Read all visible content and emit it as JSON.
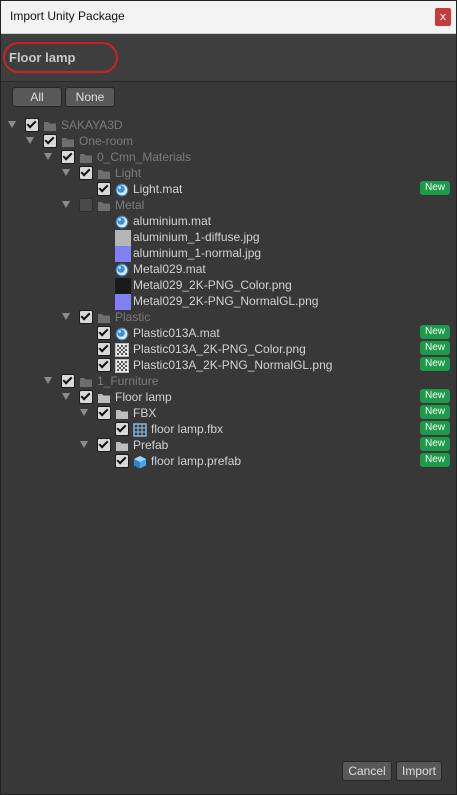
{
  "window": {
    "title": "Import Unity Package",
    "close_glyph": "x"
  },
  "package": {
    "name": "Floor lamp",
    "highlight_color": "#cc2222"
  },
  "toolbar": {
    "all_label": "All",
    "none_label": "None"
  },
  "colors": {
    "new_badge": "#1d9a4a",
    "background": "#383838",
    "title_bar": "#f3f3f3",
    "close_button": "#c43c3c"
  },
  "tree": [
    {
      "label": "SAKAYA3D",
      "depth": 0,
      "icon": "folder-icon",
      "expanded": true,
      "checked": true,
      "dim": true,
      "is_new": false
    },
    {
      "label": "One-room",
      "depth": 1,
      "icon": "folder-icon",
      "expanded": true,
      "checked": true,
      "dim": true,
      "is_new": false
    },
    {
      "label": "0_Cmn_Materials",
      "depth": 2,
      "icon": "folder-icon",
      "expanded": true,
      "checked": true,
      "dim": true,
      "is_new": false
    },
    {
      "label": "Light",
      "depth": 3,
      "icon": "folder-icon",
      "expanded": true,
      "checked": true,
      "dim": true,
      "is_new": false
    },
    {
      "label": "Light.mat",
      "depth": 4,
      "icon": "material-sphere-icon",
      "expanded": null,
      "checked": true,
      "dim": false,
      "is_new": true
    },
    {
      "label": "Metal",
      "depth": 3,
      "icon": "folder-icon",
      "expanded": true,
      "checked": false,
      "dim": true,
      "is_new": false
    },
    {
      "label": "aluminium.mat",
      "depth": 4,
      "icon": "material-sphere-icon",
      "expanded": null,
      "checked": null,
      "dim": false,
      "is_new": false
    },
    {
      "label": "aluminium_1-diffuse.jpg",
      "depth": 4,
      "icon": "texture-gray-icon",
      "expanded": null,
      "checked": null,
      "dim": false,
      "is_new": false
    },
    {
      "label": "aluminium_1-normal.jpg",
      "depth": 4,
      "icon": "texture-normal-icon",
      "expanded": null,
      "checked": null,
      "dim": false,
      "is_new": false
    },
    {
      "label": "Metal029.mat",
      "depth": 4,
      "icon": "material-sphere-icon",
      "expanded": null,
      "checked": null,
      "dim": false,
      "is_new": false
    },
    {
      "label": "Metal029_2K-PNG_Color.png",
      "depth": 4,
      "icon": "texture-dark-icon",
      "expanded": null,
      "checked": null,
      "dim": false,
      "is_new": false
    },
    {
      "label": "Metal029_2K-PNG_NormalGL.png",
      "depth": 4,
      "icon": "texture-normal-icon",
      "expanded": null,
      "checked": null,
      "dim": false,
      "is_new": false
    },
    {
      "label": "Plastic",
      "depth": 3,
      "icon": "folder-icon",
      "expanded": true,
      "checked": true,
      "dim": true,
      "is_new": false
    },
    {
      "label": "Plastic013A.mat",
      "depth": 4,
      "icon": "material-sphere-icon",
      "expanded": null,
      "checked": true,
      "dim": false,
      "is_new": true
    },
    {
      "label": "Plastic013A_2K-PNG_Color.png",
      "depth": 4,
      "icon": "texture-checker-icon",
      "expanded": null,
      "checked": true,
      "dim": false,
      "is_new": true
    },
    {
      "label": "Plastic013A_2K-PNG_NormalGL.png",
      "depth": 4,
      "icon": "texture-checker-icon",
      "expanded": null,
      "checked": true,
      "dim": false,
      "is_new": true
    },
    {
      "label": "1_Furniture",
      "depth": 2,
      "icon": "folder-icon",
      "expanded": true,
      "checked": true,
      "dim": true,
      "is_new": false
    },
    {
      "label": "Floor lamp",
      "depth": 3,
      "icon": "folder-icon",
      "expanded": true,
      "checked": true,
      "dim": false,
      "is_new": true
    },
    {
      "label": "FBX",
      "depth": 4,
      "icon": "folder-icon",
      "expanded": true,
      "checked": true,
      "dim": false,
      "is_new": true
    },
    {
      "label": "floor lamp.fbx",
      "depth": 5,
      "icon": "mesh-grid-icon",
      "expanded": null,
      "checked": true,
      "dim": false,
      "is_new": true
    },
    {
      "label": "Prefab",
      "depth": 4,
      "icon": "folder-icon",
      "expanded": true,
      "checked": true,
      "dim": false,
      "is_new": true
    },
    {
      "label": "floor lamp.prefab",
      "depth": 5,
      "icon": "prefab-cube-icon",
      "expanded": null,
      "checked": true,
      "dim": false,
      "is_new": true
    }
  ],
  "badge_label": "New",
  "footer": {
    "cancel_label": "Cancel",
    "import_label": "Import"
  }
}
